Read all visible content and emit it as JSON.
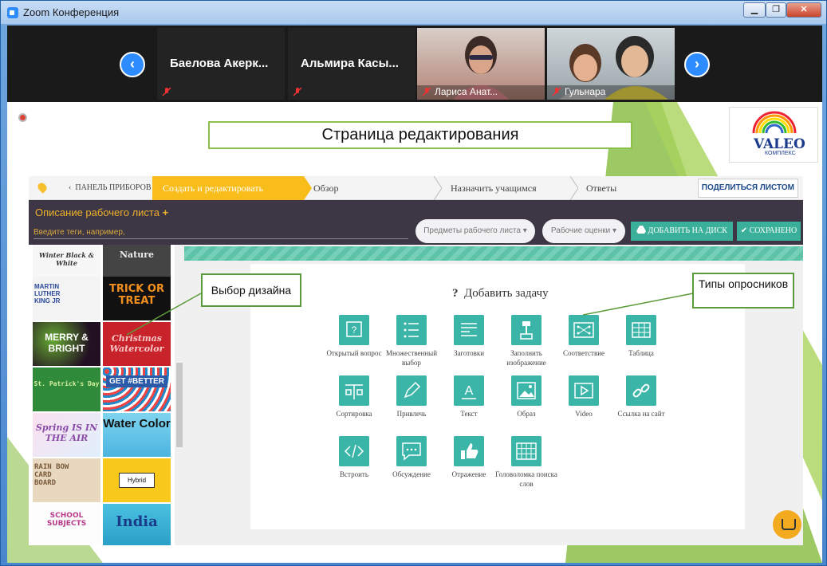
{
  "window": {
    "title": "Zoom Конференция",
    "minimize": "▁",
    "restore": "❐",
    "close": "✕"
  },
  "participants": {
    "prev": "‹",
    "next": "›",
    "tiles": [
      {
        "name": "Баелова Акерк..."
      },
      {
        "name": "Альмира Касы..."
      },
      {
        "name": "Лариса Анат..."
      },
      {
        "name": "Гульнара"
      }
    ]
  },
  "slide": {
    "title": "Страница редактирования",
    "logo_text": "VALEO",
    "logo_sub": "КОМПЛЕКС",
    "callout_design": "Выбор дизайна",
    "callout_types": "Типы опросников"
  },
  "app": {
    "steps": {
      "dashboard": "ПАНЕЛЬ ПРИБОРОВ",
      "create": "Создать и редактировать",
      "overview": "Обзор",
      "assign": "Назначить учащимся",
      "answers": "Ответы"
    },
    "share": "ПОДЕЛИТЬСЯ ЛИСТОМ",
    "description": "Описание рабочего листа",
    "plus": "+",
    "tags_placeholder": "Введите теги, например,",
    "subjects": "Предметы рабочего листа",
    "grades": "Рабочие оценки",
    "add_drive": "ДОБАВИТЬ НА ДИСК",
    "saved": "СОХРАНЕНО",
    "add_task": "Добавить задачу",
    "help": "?",
    "gallery": {
      "t1": "Winter Black & White",
      "t2": "Nature",
      "t3": "MARTIN LUTHER KING JR",
      "t4": "TRICK OR TREAT",
      "t5": "MERRY & BRIGHT",
      "t6": "Christmas Watercolor",
      "t7": "St. Patrick's Day",
      "t8": "GET #BETTER",
      "t9": "Spring IS IN THE AIR",
      "t10": "Water Color",
      "t11": "RAIN BOW CARD BOARD",
      "t12": "Hybrid",
      "t13": "SCHOOL SUBJECTS",
      "t14": "India"
    },
    "question_types": [
      {
        "label": "Открытый вопрос",
        "icon": "open-question-icon"
      },
      {
        "label": "Множественный выбор",
        "icon": "multiple-choice-icon"
      },
      {
        "label": "Заготовки",
        "icon": "blanks-icon"
      },
      {
        "label": "Заполнить изображение",
        "icon": "fill-image-icon"
      },
      {
        "label": "Соответствие",
        "icon": "matching-icon"
      },
      {
        "label": "Таблица",
        "icon": "table-icon"
      },
      {
        "label": "Сортировка",
        "icon": "sorting-icon"
      },
      {
        "label": "Привлечь",
        "icon": "draw-icon"
      },
      {
        "label": "Текст",
        "icon": "text-icon"
      },
      {
        "label": "Образ",
        "icon": "image-icon"
      },
      {
        "label": "Video",
        "icon": "video-icon"
      },
      {
        "label": "Ссылка на сайт",
        "icon": "link-icon"
      },
      {
        "label": "Встроить",
        "icon": "embed-icon"
      },
      {
        "label": "Обсуждение",
        "icon": "discussion-icon"
      },
      {
        "label": "Отражение",
        "icon": "reflection-icon"
      },
      {
        "label": "Головоломка поиска слов",
        "icon": "word-search-icon"
      }
    ]
  },
  "colors": {
    "accent": "#f8bd1b",
    "teal": "#3ab5a8",
    "dark": "#3c3645",
    "zoom_blue": "#2d8cff",
    "green": "#8cc04a"
  }
}
